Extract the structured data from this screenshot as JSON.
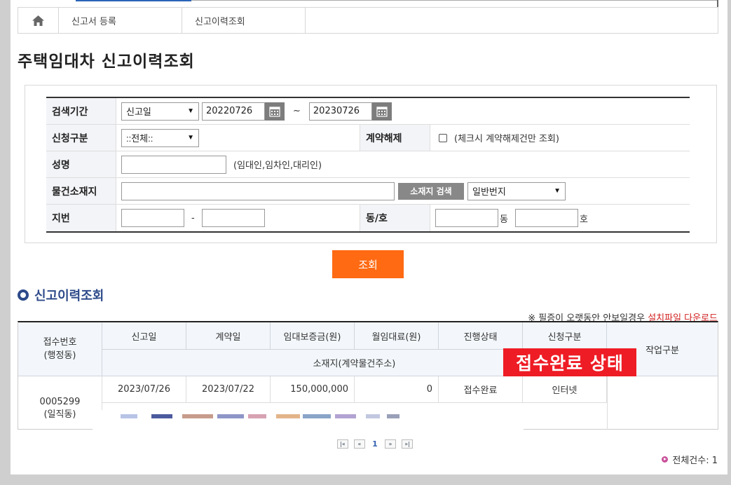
{
  "breadcrumb": {
    "items": [
      "신고서 등록",
      "신고이력조회"
    ]
  },
  "page": {
    "title": "주택임대차 신고이력조회"
  },
  "search": {
    "period_label": "검색기간",
    "period_type": "신고일",
    "date_from": "20220726",
    "date_sep": "~",
    "date_to": "20230726",
    "apply_type_label": "신청구분",
    "apply_type_value": "::전체::",
    "cancel_label": "계약해제",
    "cancel_note": "(체크시 계약해제건만 조회)",
    "name_label": "성명",
    "name_value": "",
    "name_note": "(임대인,임차인,대리인)",
    "address_label": "물건소재지",
    "address_value": "",
    "address_search_button": "소재지 검색",
    "address_type": "일반번지",
    "lot_label": "지번",
    "lot_sep": "-",
    "lot_main": "",
    "lot_sub": "",
    "dong_ho_label": "동/호",
    "dong_value": "",
    "dong_suffix": "동",
    "ho_value": "",
    "ho_suffix": "호"
  },
  "submit_button": "조회",
  "results": {
    "section_title": "신고이력조회",
    "notice_text": "※ 필증이 오랫동안 안보일경우",
    "notice_link": "설치파일 다운로드",
    "headers": {
      "receipt_no": "접수번호",
      "receipt_sub": "(행정동)",
      "report_date": "신고일",
      "contract_date": "계약일",
      "deposit": "임대보증금(원)",
      "monthly_rent": "월임대료(원)",
      "status": "진행상태",
      "apply_type": "신청구분",
      "work_type": "작업구분",
      "location": "소재지(계약물건주소)"
    },
    "rows": [
      {
        "receipt_no": "0005299",
        "admin_dong": "(일직동)",
        "report_date": "2023/07/26",
        "contract_date": "2023/07/22",
        "deposit": "150,000,000",
        "monthly_rent": "0",
        "status": "접수완료",
        "apply_type": "인터넷"
      }
    ],
    "overlay_label": "접수완료 상태",
    "total_text": "전체건수: 1"
  },
  "pager": {
    "first": "처음",
    "prev": "이전",
    "current": "1",
    "next": "다음",
    "last": "마지막"
  },
  "colors": {
    "accent_orange": "#ff6a13",
    "title_blue": "#2d4a8a",
    "overlay_red": "#ee1c25"
  }
}
